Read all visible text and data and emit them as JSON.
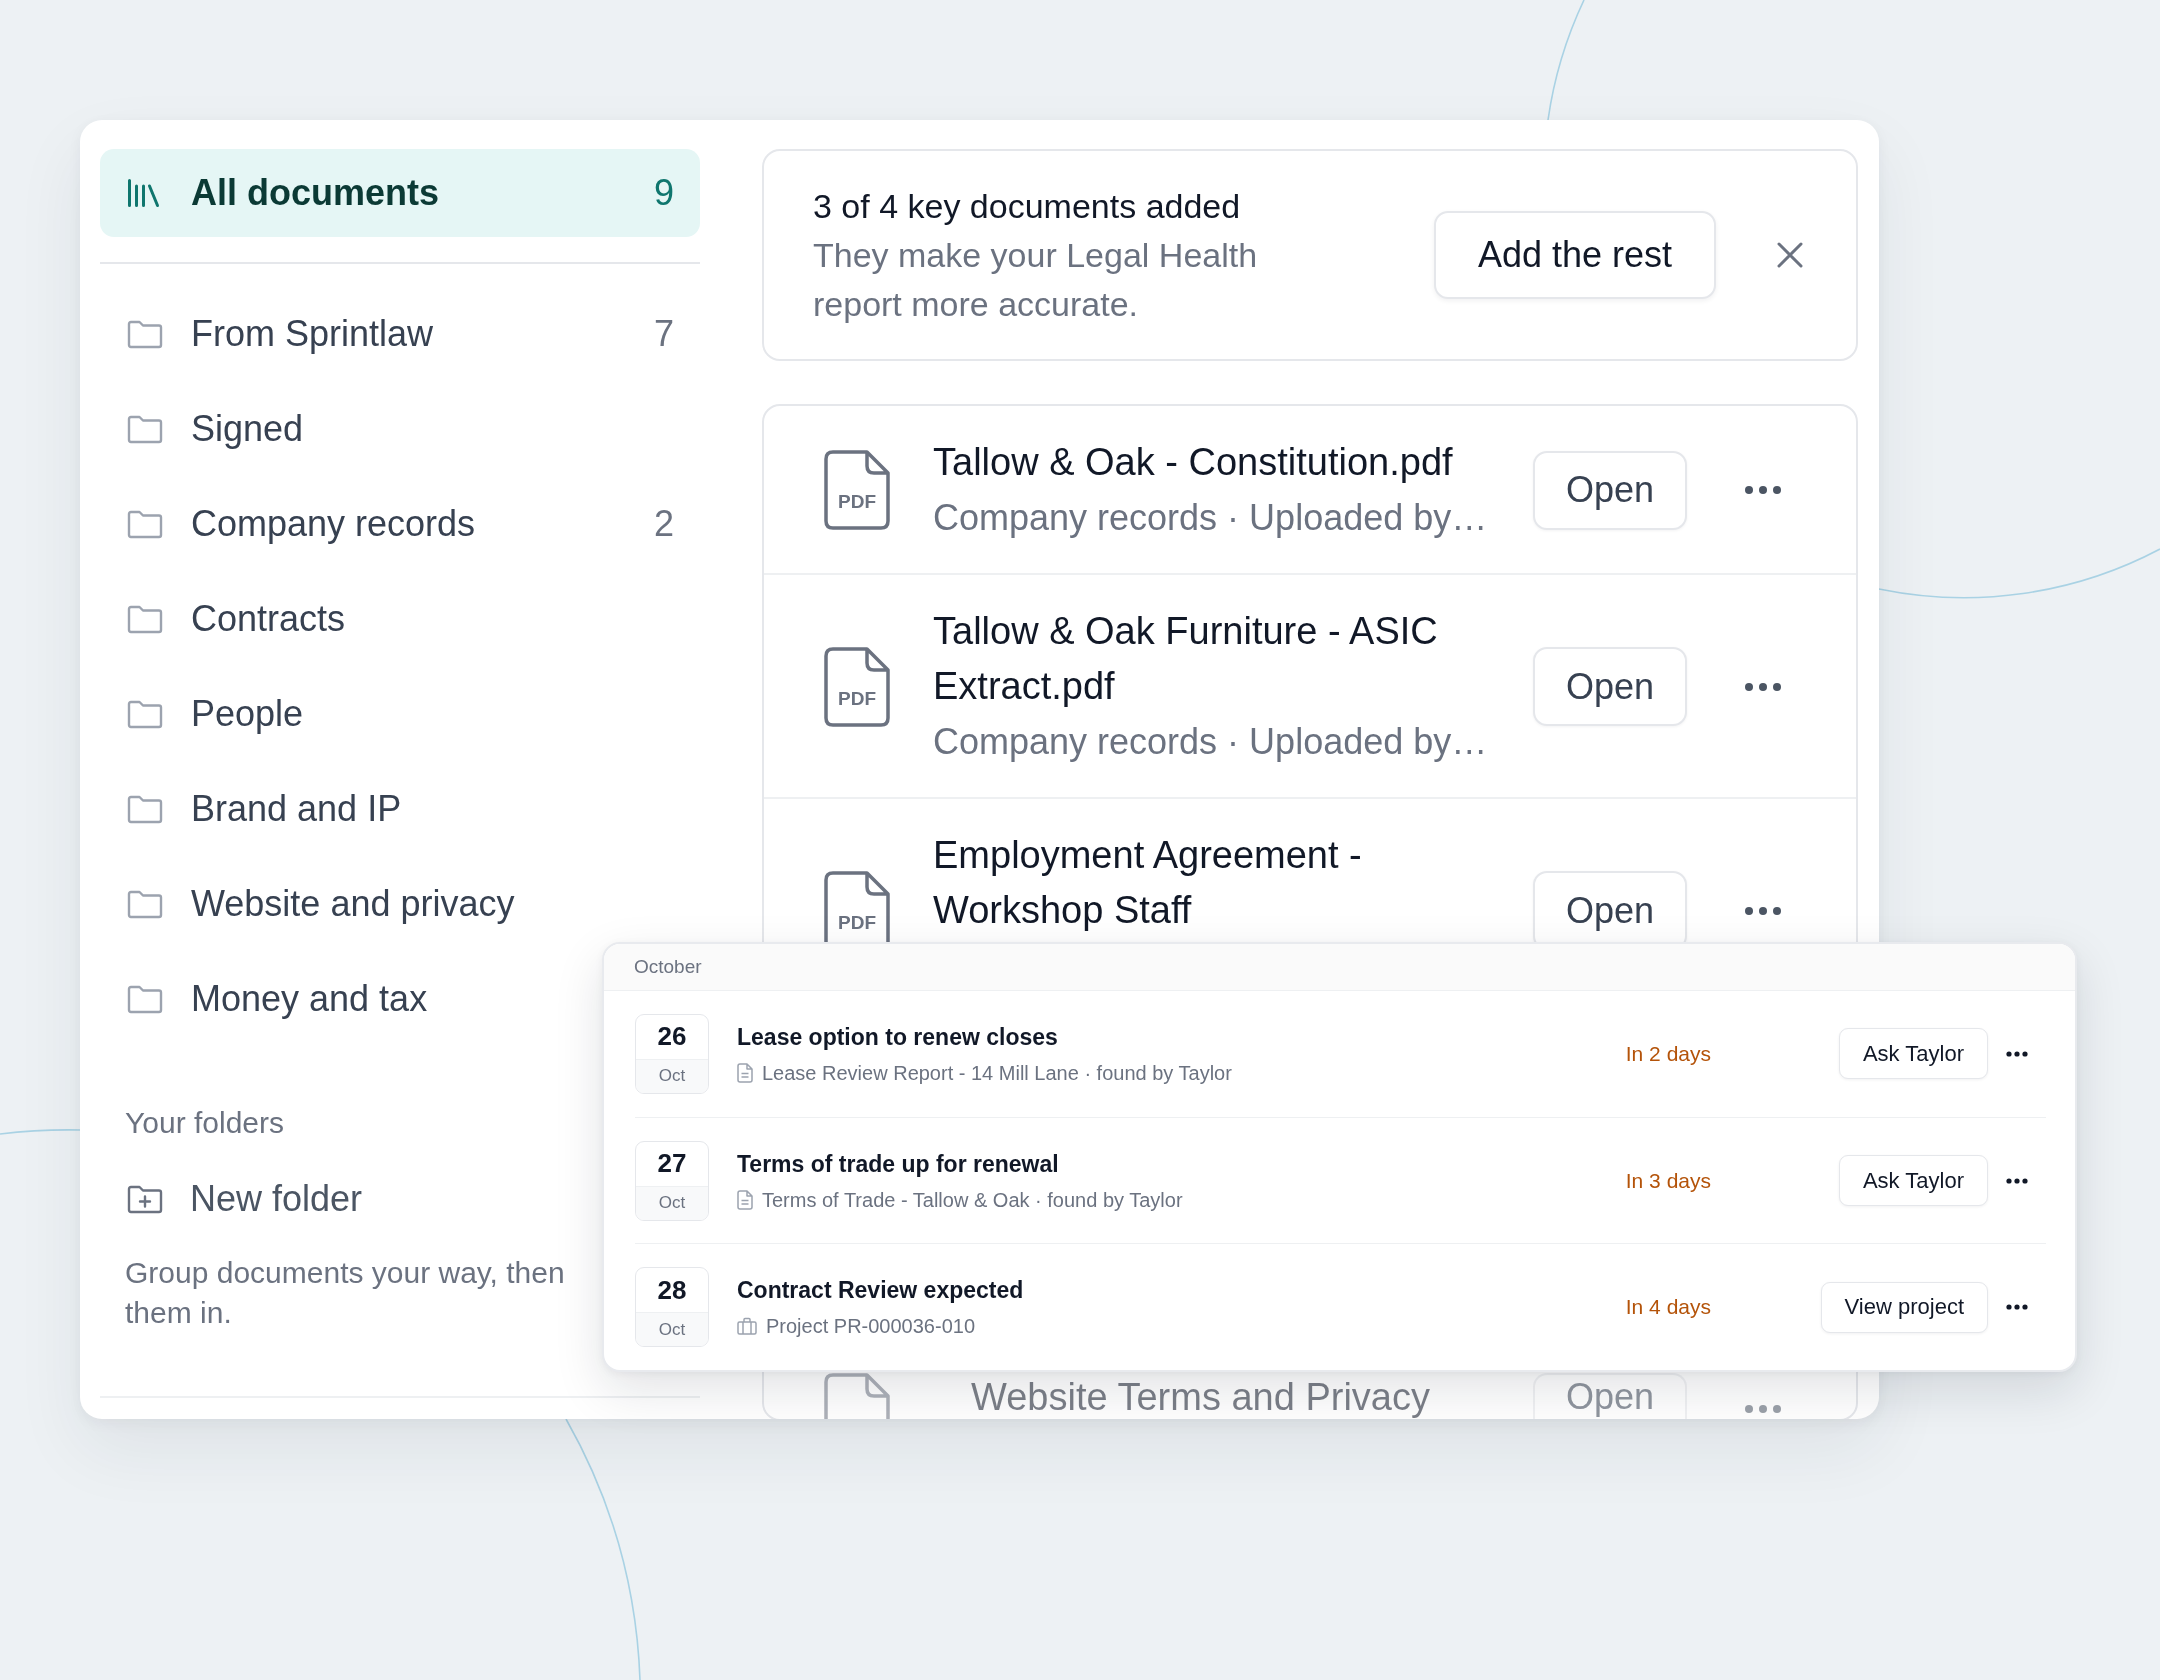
{
  "sidebar": {
    "items": [
      {
        "kind": "library",
        "label": "All documents",
        "count": "9",
        "selected": true
      },
      {
        "kind": "folder",
        "label": "From Sprintlaw",
        "count": "7",
        "selected": false
      },
      {
        "kind": "folder",
        "label": "Signed",
        "selected": false
      },
      {
        "kind": "folder",
        "label": "Company records",
        "count": "2",
        "selected": false
      },
      {
        "kind": "folder",
        "label": "Contracts",
        "selected": false
      },
      {
        "kind": "folder",
        "label": "People",
        "selected": false
      },
      {
        "kind": "folder",
        "label": "Brand and IP",
        "selected": false
      },
      {
        "kind": "folder",
        "label": "Website and privacy",
        "selected": false
      },
      {
        "kind": "folder",
        "label": "Money and tax",
        "selected": false
      }
    ],
    "section_heading": "Your folders",
    "new_folder_button": "New folder",
    "hint": "Group documents your way, then them in."
  },
  "banner": {
    "title": "3 of 4 key documents added",
    "text": "They make your Legal Health report more accurate.",
    "button": "Add the rest"
  },
  "documents": [
    {
      "icon_label": "PDF",
      "title": "Tallow & Oak - Constitution.pdf",
      "meta": "Company records · Uploaded by…",
      "button": "Open"
    },
    {
      "icon_label": "PDF",
      "title": "Tallow & Oak Furniture - ASIC Extract.pdf",
      "meta": "Company records · Uploaded by…",
      "button": "Open"
    },
    {
      "icon_label": "PDF",
      "title": "Employment Agreement - Workshop Staff",
      "button": "Open"
    },
    {
      "title": "Website Terms and Privacy",
      "button": "Open"
    }
  ],
  "reminders": {
    "month": "October",
    "items": [
      {
        "day": "26",
        "month": "Oct",
        "title": "Lease option to renew closes",
        "kind": "document",
        "source": "Lease Review Report - 14 Mill Lane · found by Taylor",
        "due": "In 2 days",
        "button": "Ask Taylor"
      },
      {
        "day": "27",
        "month": "Oct",
        "title": "Terms of trade up for renewal",
        "kind": "document",
        "source": "Terms of Trade - Tallow & Oak · found by Taylor",
        "due": "In 3 days",
        "button": "Ask Taylor"
      },
      {
        "day": "28",
        "month": "Oct",
        "title": "Contract Review expected",
        "kind": "project",
        "source": "Project PR-000036-010",
        "due": "In 4 days",
        "button": "View project"
      }
    ]
  }
}
